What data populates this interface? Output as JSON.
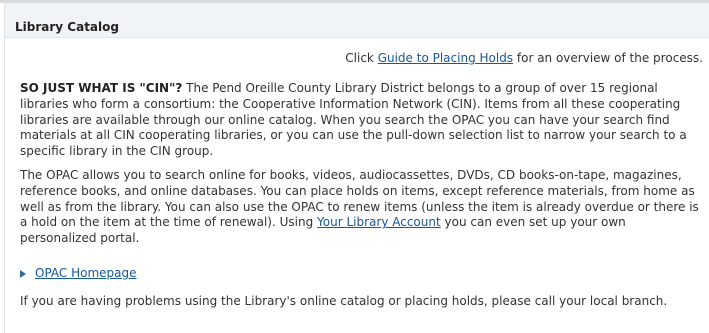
{
  "header": {
    "title": "Library Catalog"
  },
  "guide": {
    "prefix": "Click ",
    "link_text": "Guide to Placing Holds",
    "suffix": " for an overview of the process."
  },
  "intro": {
    "lead": "SO JUST WHAT IS \"CIN\"?",
    "body": " The Pend Oreille County Library District belongs to a group of over 15 regional libraries who form a consortium: the Cooperative Information Network (CIN). Items from all these cooperating libraries are available through our online catalog. When you search the OPAC you can have your search find materials at all CIN cooperating libraries, or you can use the pull-down selection list to narrow your search to a specific library in the CIN group."
  },
  "opac_info": {
    "text_before_link": "The OPAC allows you to search online for books, videos, audiocassettes, DVDs, CD books-on-tape, magazines, reference books, and online databases. You can place holds on items, except reference materials, from home as well as from the library. You can also use the OPAC to renew items (unless the item is already overdue or there is a hold on the item at the time of renewal). Using ",
    "link_text": "Your Library Account",
    "text_after_link": " you can even set up your own personalized portal."
  },
  "opac_homepage": {
    "link_text": "OPAC Homepage"
  },
  "help": {
    "text": "If you are having problems using the Library's online catalog or placing holds, please call your local branch."
  },
  "colors": {
    "link": "#16589a",
    "header_bg": "#f1f4f7",
    "text": "#333333",
    "bullet": "#2e6aa8"
  },
  "icons": {
    "bullet": "triangle-right-icon"
  }
}
